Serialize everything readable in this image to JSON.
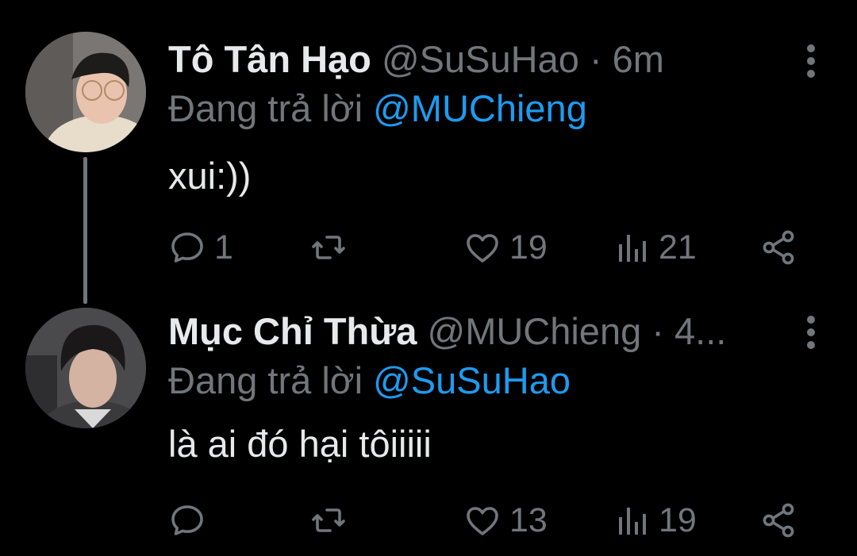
{
  "tweets": [
    {
      "author_name": "Tô Tân Hạo",
      "handle": "@SuSuHao",
      "separator": "·",
      "time": "6m",
      "replying_prefix": "Đang trả lời",
      "replying_to": "@MUChieng",
      "text": "xui:))",
      "counts": {
        "reply": "1",
        "retweet": "",
        "like": "19",
        "views": "21"
      }
    },
    {
      "author_name": "Mục Chỉ Thừa",
      "handle": "@MUChieng",
      "separator": "·",
      "time": "4...",
      "replying_prefix": "Đang trả lời",
      "replying_to": "@SuSuHao",
      "text": "là ai đó hại tôiiiii",
      "counts": {
        "reply": "",
        "retweet": "",
        "like": "13",
        "views": "19"
      }
    }
  ],
  "icons": {
    "reply": "speech-bubble-icon",
    "retweet": "retweet-arrows-icon",
    "like": "heart-icon",
    "views": "bar-chart-icon",
    "share": "share-icon",
    "more": "vertical-dots-icon"
  },
  "colors": {
    "background": "#000000",
    "text_primary": "#e7e9ea",
    "text_secondary": "#71767b",
    "accent": "#1d9bf0",
    "thread_line": "#6e767d"
  }
}
